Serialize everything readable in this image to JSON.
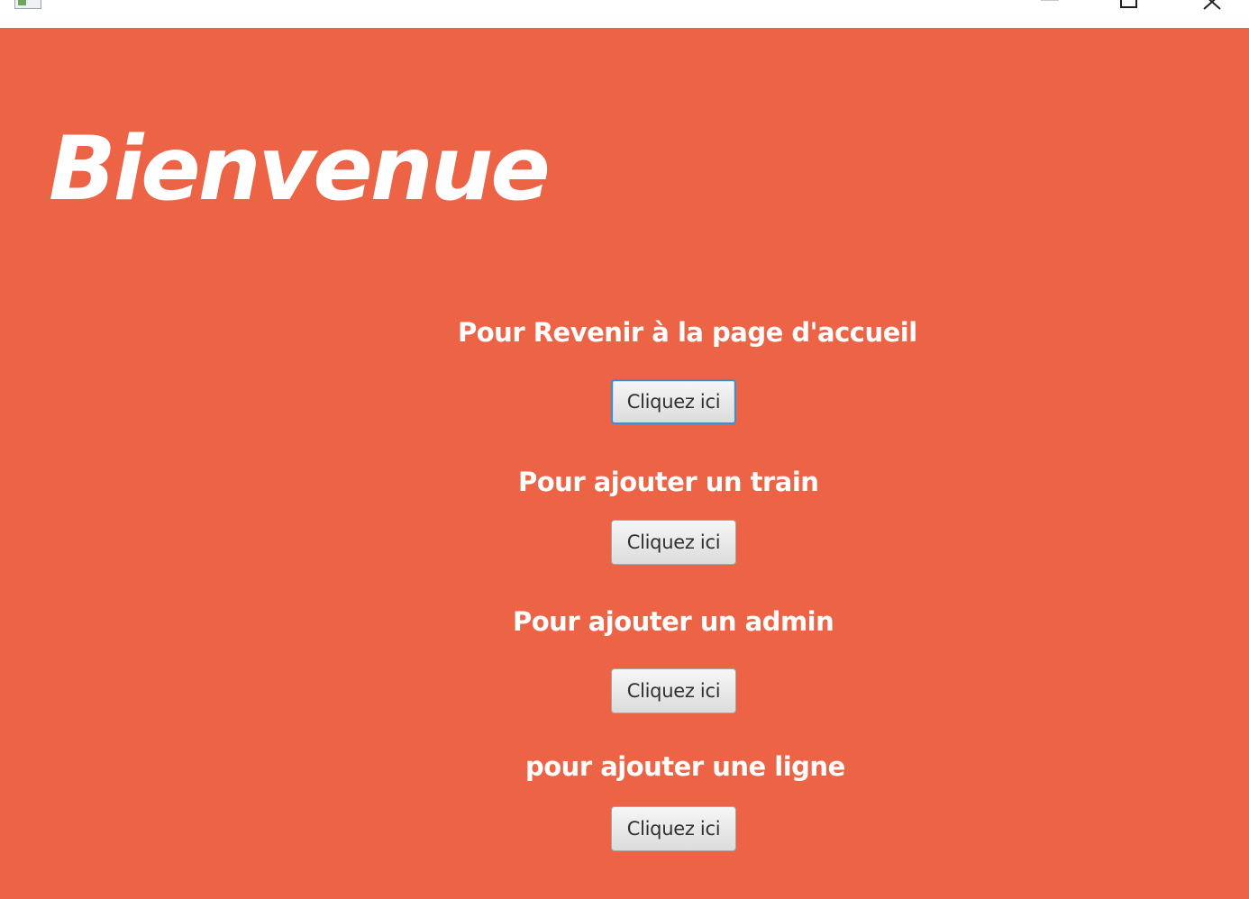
{
  "window": {
    "controls": {
      "minimize_icon": "minimize-icon",
      "maximize_icon": "maximize-icon",
      "close_icon": "close-icon"
    }
  },
  "main": {
    "title": "Bienvenue",
    "background_color": "#ec6345",
    "sections": [
      {
        "label": "Pour Revenir à la page d'accueil",
        "button_label": "Cliquez ici",
        "focused": true
      },
      {
        "label": "Pour ajouter un train",
        "button_label": "Cliquez ici",
        "focused": false
      },
      {
        "label": "Pour ajouter un admin",
        "button_label": "Cliquez ici",
        "focused": false
      },
      {
        "label": "pour ajouter une ligne",
        "button_label": "Cliquez ici",
        "focused": false
      }
    ]
  }
}
